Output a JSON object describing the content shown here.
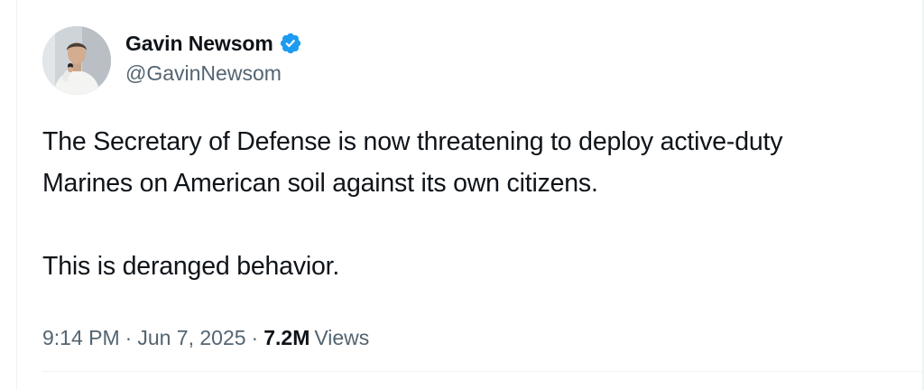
{
  "tweet": {
    "author": {
      "display_name": "Gavin Newsom",
      "handle": "@GavinNewsom",
      "verified_icon": "verified-badge-icon",
      "avatar_icon": "profile-photo"
    },
    "text": {
      "line1": "The Secretary of Defense is now threatening to deploy active-duty",
      "line2": "Marines on American soil against its own citizens.",
      "line3": "This is deranged behavior."
    },
    "meta": {
      "time": "9:14 PM",
      "separator": "·",
      "date": "Jun 7, 2025",
      "views_count": "7.2M",
      "views_label": "Views"
    }
  },
  "colors": {
    "primary_text": "#0f1419",
    "secondary_text": "#536471",
    "verified_blue": "#1d9bf0",
    "divider": "#eff3f4"
  }
}
